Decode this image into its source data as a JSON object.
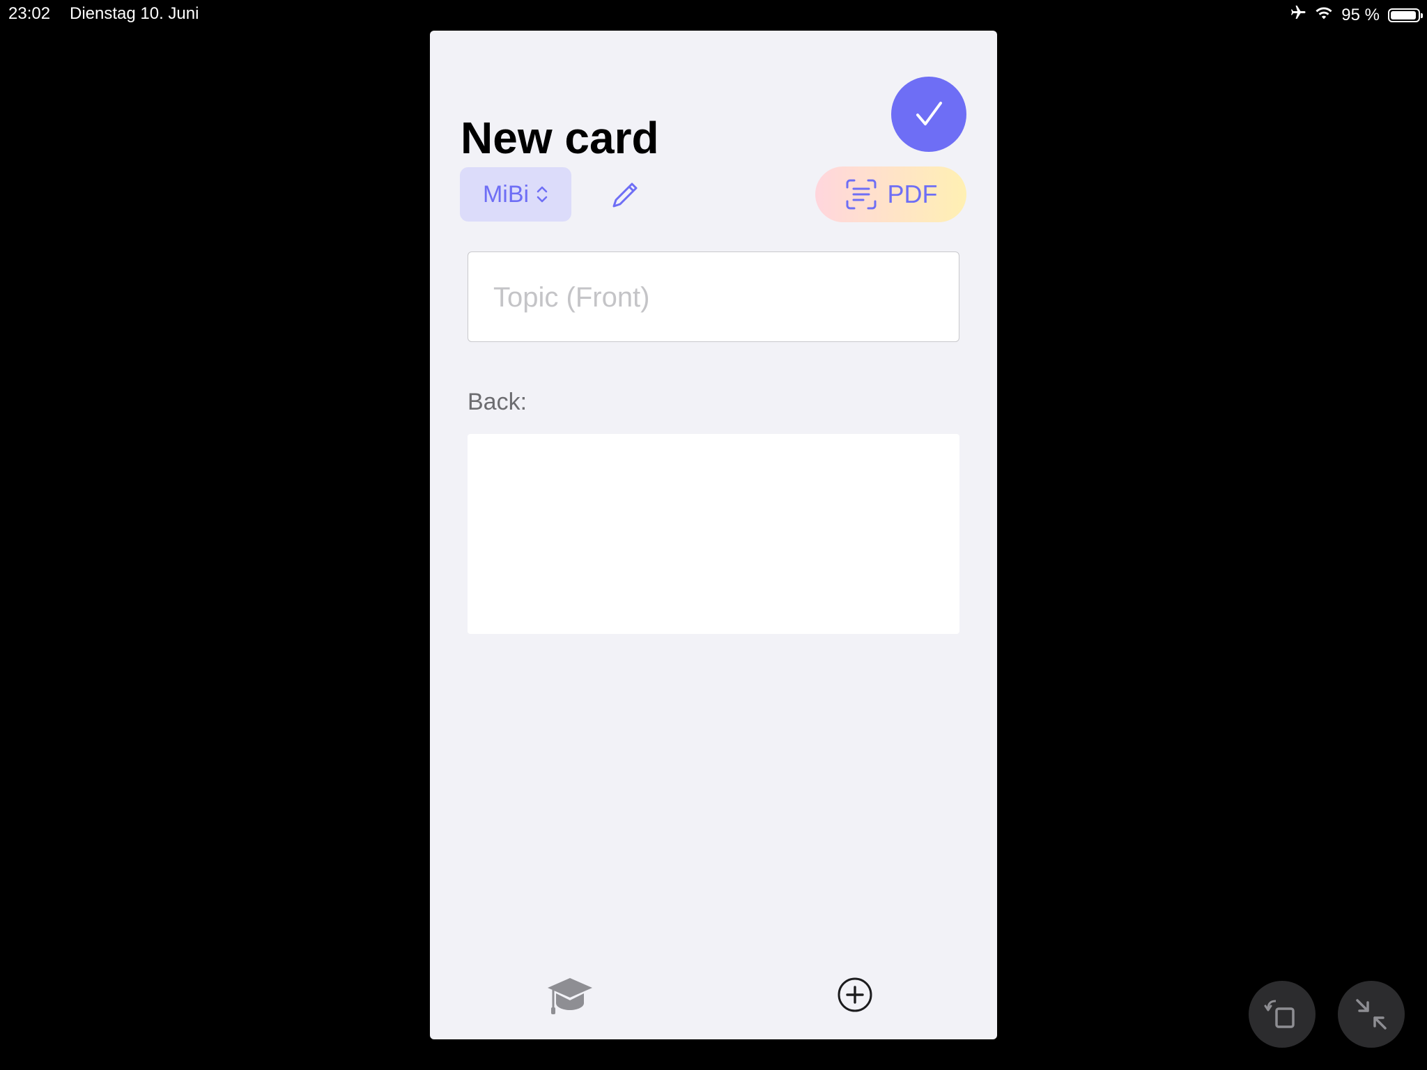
{
  "status_bar": {
    "time": "23:02",
    "date": "Dienstag 10. Juni",
    "battery_percent_label": "95 %",
    "battery_level": 0.95,
    "icons": [
      "airplane-icon",
      "wifi-icon",
      "battery-icon"
    ]
  },
  "editor": {
    "title": "New card",
    "deck": "MiBi",
    "pdf_label": "PDF",
    "front": {
      "placeholder": "Topic (Front)",
      "value": ""
    },
    "back_label": "Back:",
    "back_value": ""
  },
  "tab_bar": {
    "icons": [
      "graduation-cap-icon",
      "plus-circle-icon"
    ]
  },
  "floating_controls": {
    "icons": [
      "rotate-icon",
      "collapse-icon"
    ]
  },
  "colors": {
    "accent": "#6e6ef5",
    "accent_light": "#dcdcfa",
    "window_bg": "#f2f2f7",
    "pdf_gradient_start": "#ffd6dd",
    "pdf_gradient_end": "#fff0b3",
    "icon_gray": "#8e8e93"
  }
}
